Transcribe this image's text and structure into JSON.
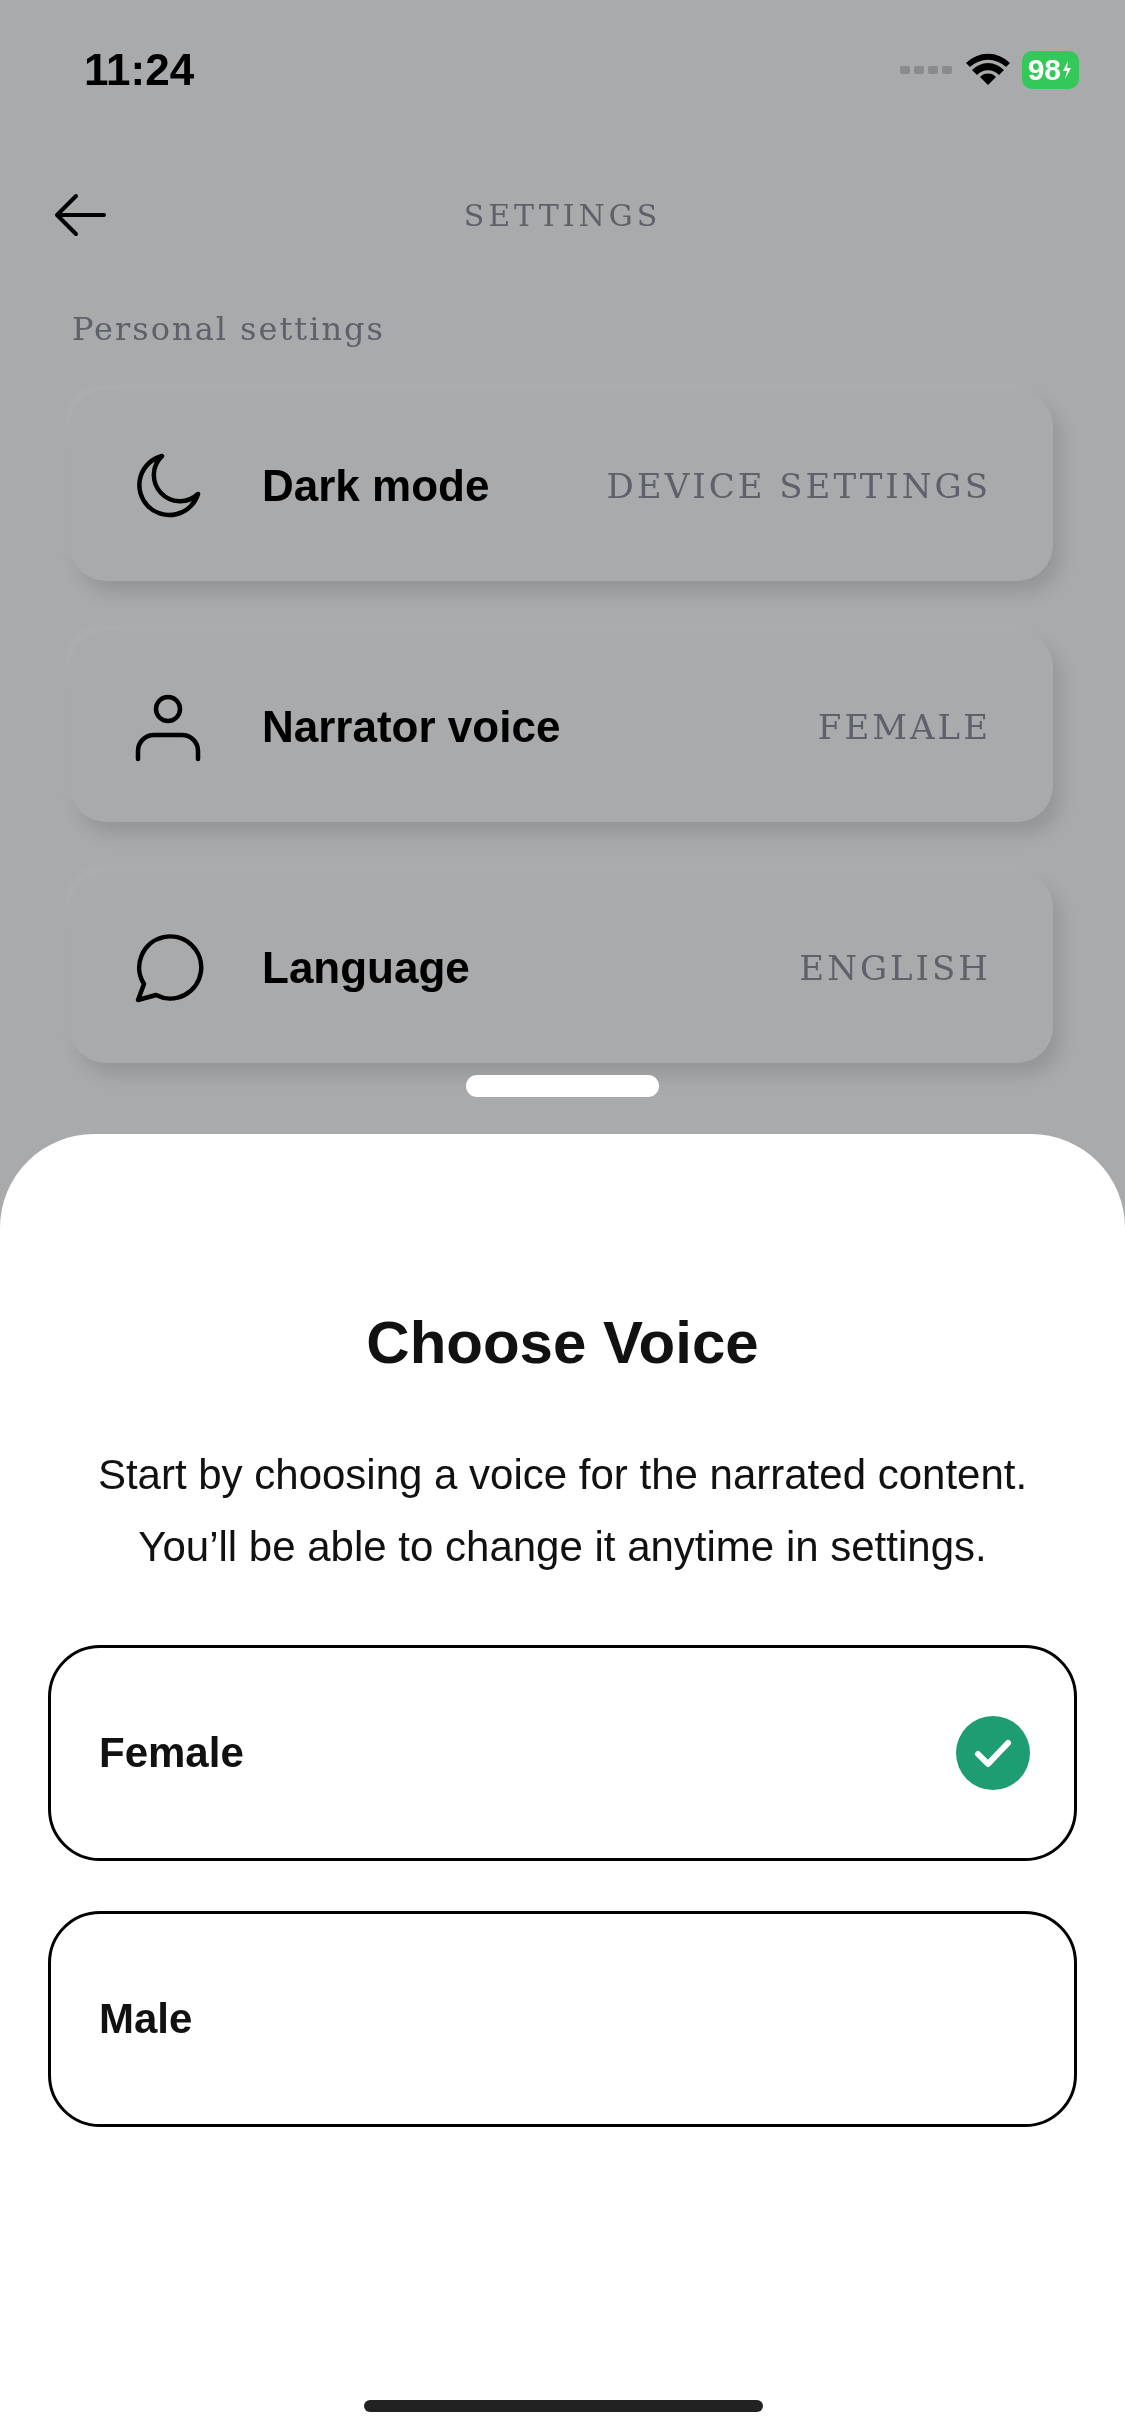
{
  "status_bar": {
    "time": "11:24",
    "battery": "98"
  },
  "header": {
    "title": "SETTINGS"
  },
  "section_label": "Personal settings",
  "settings": [
    {
      "kind": "moon",
      "label": "Dark mode",
      "value": "DEVICE SETTINGS"
    },
    {
      "kind": "person",
      "label": "Narrator voice",
      "value": "FEMALE"
    },
    {
      "kind": "chat",
      "label": "Language",
      "value": "ENGLISH"
    }
  ],
  "sheet": {
    "title": "Choose Voice",
    "description": "Start by choosing a voice for the narrated content. You’ll be able to change it anytime in settings.",
    "options": [
      {
        "label": "Female",
        "selected": true
      },
      {
        "label": "Male",
        "selected": false
      }
    ]
  }
}
